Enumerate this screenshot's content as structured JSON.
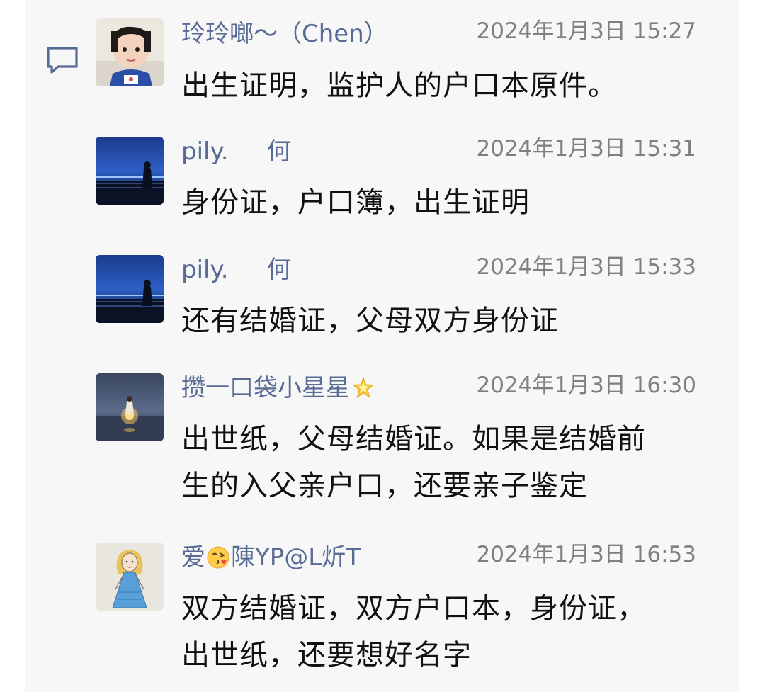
{
  "comments": [
    {
      "name": "玲玲啷～（Chen）",
      "time": "2024年1月3日 15:27",
      "text": "出生证明，监护人的户口本原件。"
    },
    {
      "name": "pily.     何",
      "time": "2024年1月3日 15:31",
      "text": "身份证，户口簿，出生证明"
    },
    {
      "name": "pily.     何",
      "time": "2024年1月3日 15:33",
      "text": "还有结婚证，父母双方身份证"
    },
    {
      "name": "攒一口袋小星星",
      "name_emoji": "sparkle-star-icon",
      "time": "2024年1月3日 16:30",
      "text_lines": [
        "出世纸，父母结婚证。如果是结婚前",
        "生的入父亲户口，还要亲子鉴定"
      ]
    },
    {
      "name_prefix": "爱",
      "name_emoji": "kissing-face-icon",
      "name_suffix": "陳YP@L炘T",
      "time": "2024年1月3日 16:53",
      "text_lines": [
        "双方结婚证，双方户口本，身份证，",
        "出世纸，还要想好名字"
      ]
    }
  ],
  "colors": {
    "name": "#576b95",
    "time": "#7f7f7f",
    "text": "#111111",
    "panel": "#f7f7f7"
  }
}
